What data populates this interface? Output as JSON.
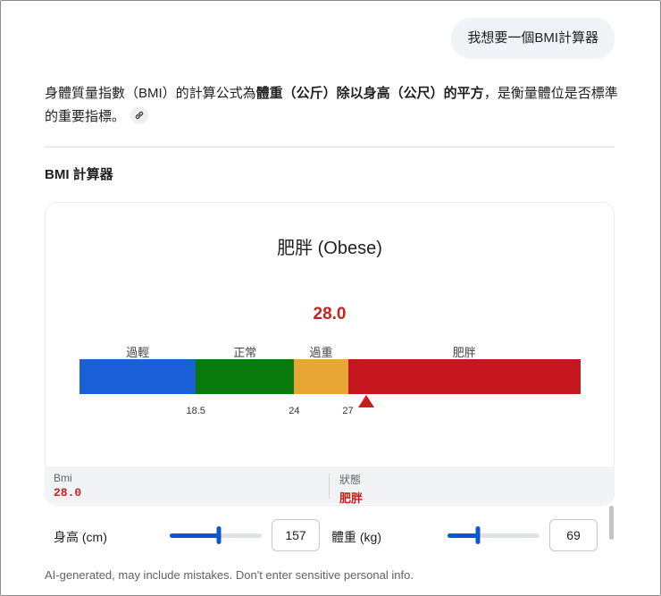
{
  "chat": {
    "user_message": "我想要一個BMI計算器"
  },
  "intro": {
    "part1": "身體質量指數（BMI）的計算公式為",
    "bold": "體重（公斤）除以身高（公尺）的平方",
    "part2": "，是衡量體位是否標準的重要指標。"
  },
  "section_title": "BMI 計算器",
  "calculator": {
    "category": "肥胖 (Obese)",
    "bmi_value": "28.0",
    "scale": {
      "min": 12,
      "max": 40,
      "current": 28.0,
      "segments": [
        {
          "label": "過輕",
          "color": "#1a5fd6",
          "from": 12,
          "to": 18.5
        },
        {
          "label": "正常",
          "color": "#08790b",
          "from": 18.5,
          "to": 24
        },
        {
          "label": "過重",
          "color": "#e8a735",
          "from": 24,
          "to": 27
        },
        {
          "label": "肥胖",
          "color": "#c5161f",
          "from": 27,
          "to": 40
        }
      ],
      "ticks": [
        "18.5",
        "24",
        "27"
      ]
    },
    "info": {
      "bmi_label": "Bmi",
      "bmi_value": "28.0",
      "status_label": "狀態",
      "status_value": "肥胖"
    },
    "height": {
      "label": "身高 (cm)",
      "value": "157",
      "slider_fraction": 0.53
    },
    "weight": {
      "label": "體重 (kg)",
      "value": "69",
      "slider_fraction": 0.33
    }
  },
  "disclaimer": "AI-generated, may include mistakes. Don't enter sensitive personal info.",
  "colors": {
    "accent": "#0b57d0",
    "alert": "#c5221f"
  }
}
